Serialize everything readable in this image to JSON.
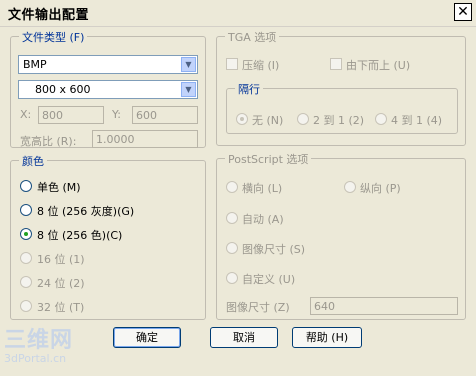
{
  "window": {
    "title": "文件输出配置",
    "close_glyph": "✕"
  },
  "format_group": {
    "legend": "文件类型 (F)",
    "type_value": "BMP",
    "size_value": "800 x 600",
    "x_label": "X:",
    "x_value": "800",
    "y_label": "Y:",
    "y_value": "600",
    "aspect_label": "宽高比 (R):",
    "aspect_value": "1.0000"
  },
  "color_group": {
    "legend": "颜色",
    "options": [
      {
        "label": "单色 (M)",
        "selected": false,
        "enabled": true
      },
      {
        "label": "8 位 (256 灰度)(G)",
        "selected": false,
        "enabled": true
      },
      {
        "label": "8 位 (256 色)(C)",
        "selected": true,
        "enabled": true
      },
      {
        "label": "16 位 (1)",
        "selected": false,
        "enabled": false
      },
      {
        "label": "24 位 (2)",
        "selected": false,
        "enabled": false
      },
      {
        "label": "32 位 (T)",
        "selected": false,
        "enabled": false
      }
    ]
  },
  "tga_group": {
    "legend": "TGA 选项",
    "compress_label": "压缩 (I)",
    "bottom_up_label": "由下而上 (U)",
    "interlace": {
      "legend": "隔行",
      "none_label": "无 (N)",
      "two_to_one_label": "2 到 1 (2)",
      "four_to_one_label": "4 到 1 (4)"
    }
  },
  "postscript_group": {
    "legend": "PostScript 选项",
    "landscape_label": "横向 (L)",
    "portrait_label": "纵向 (P)",
    "auto_label": "自动 (A)",
    "image_size_label": "图像尺寸 (S)",
    "custom_label": "自定义 (U)",
    "image_size_field_label": "图像尺寸 (Z)",
    "image_size_field_value": "640"
  },
  "buttons": {
    "ok": "确定",
    "cancel": "取消",
    "help": "帮助 (H)"
  },
  "watermark": {
    "logo_text": "三维网",
    "url": "3dPortal.cn"
  }
}
